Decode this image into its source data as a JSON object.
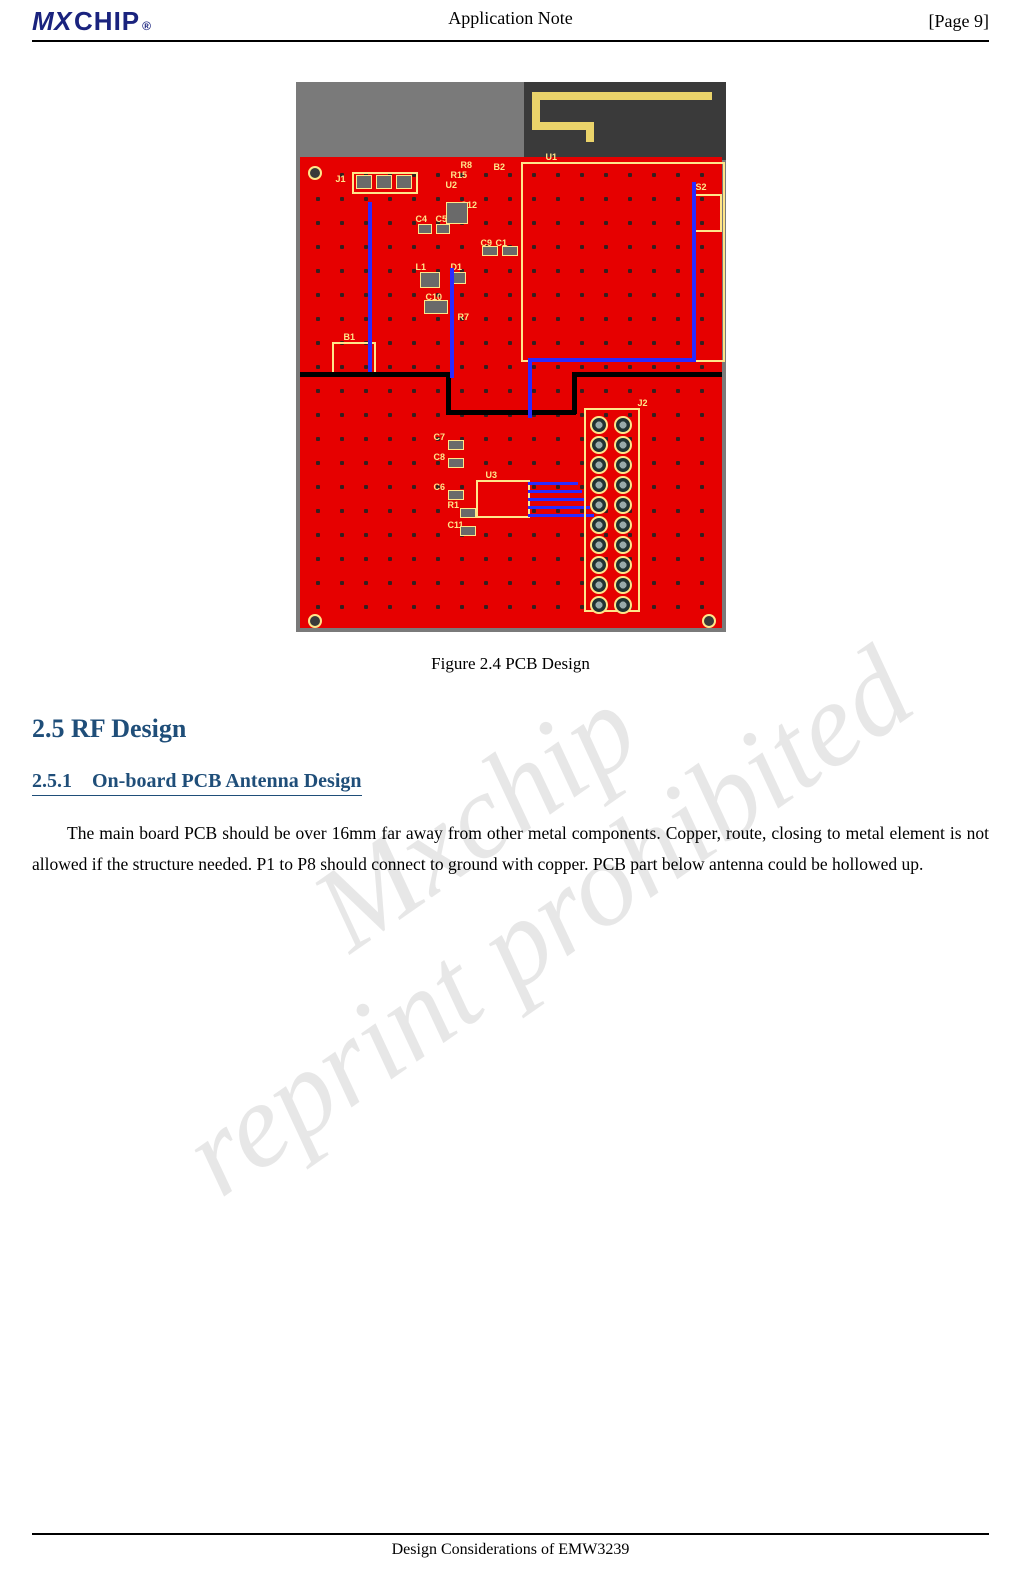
{
  "header": {
    "logo_m": "M",
    "logo_x": "X",
    "logo_chip": "CHIP",
    "logo_reg": "®",
    "center": "Application  Note",
    "right": "[Page  9]"
  },
  "figure": {
    "caption": "Figure 2.4 PCB Design",
    "refs": {
      "u1": "U1",
      "u2": "U2",
      "u3": "U3",
      "r7": "R7",
      "r8": "R8",
      "r15": "R15",
      "r1": "R1",
      "c4": "C4",
      "c5": "C5",
      "c9": "C9",
      "c10": "C10",
      "c7": "C7",
      "c8": "C8",
      "c6": "C6",
      "c11": "C11",
      "c1": "C1",
      "c12": "C12",
      "l1": "L1",
      "d1": "D1",
      "b1": "B1",
      "b2": "B2",
      "j1": "J1",
      "j2": "J2",
      "s2": "S2"
    }
  },
  "sections": {
    "h2_num": "2.5",
    "h2_title": "RF Design",
    "h3_num": "2.5.1",
    "h3_title": "On-board PCB Antenna Design",
    "body": "The main board PCB should be over 16mm far away from other metal components. Copper, route, closing to metal element is not allowed if the structure needed. P1 to P8 should connect to ground with copper. PCB part below antenna could be hollowed up."
  },
  "watermark": {
    "line1": "Mxchip",
    "line2": "reprint prohibited"
  },
  "footer": {
    "text": "Design Considerations of EMW3239"
  }
}
